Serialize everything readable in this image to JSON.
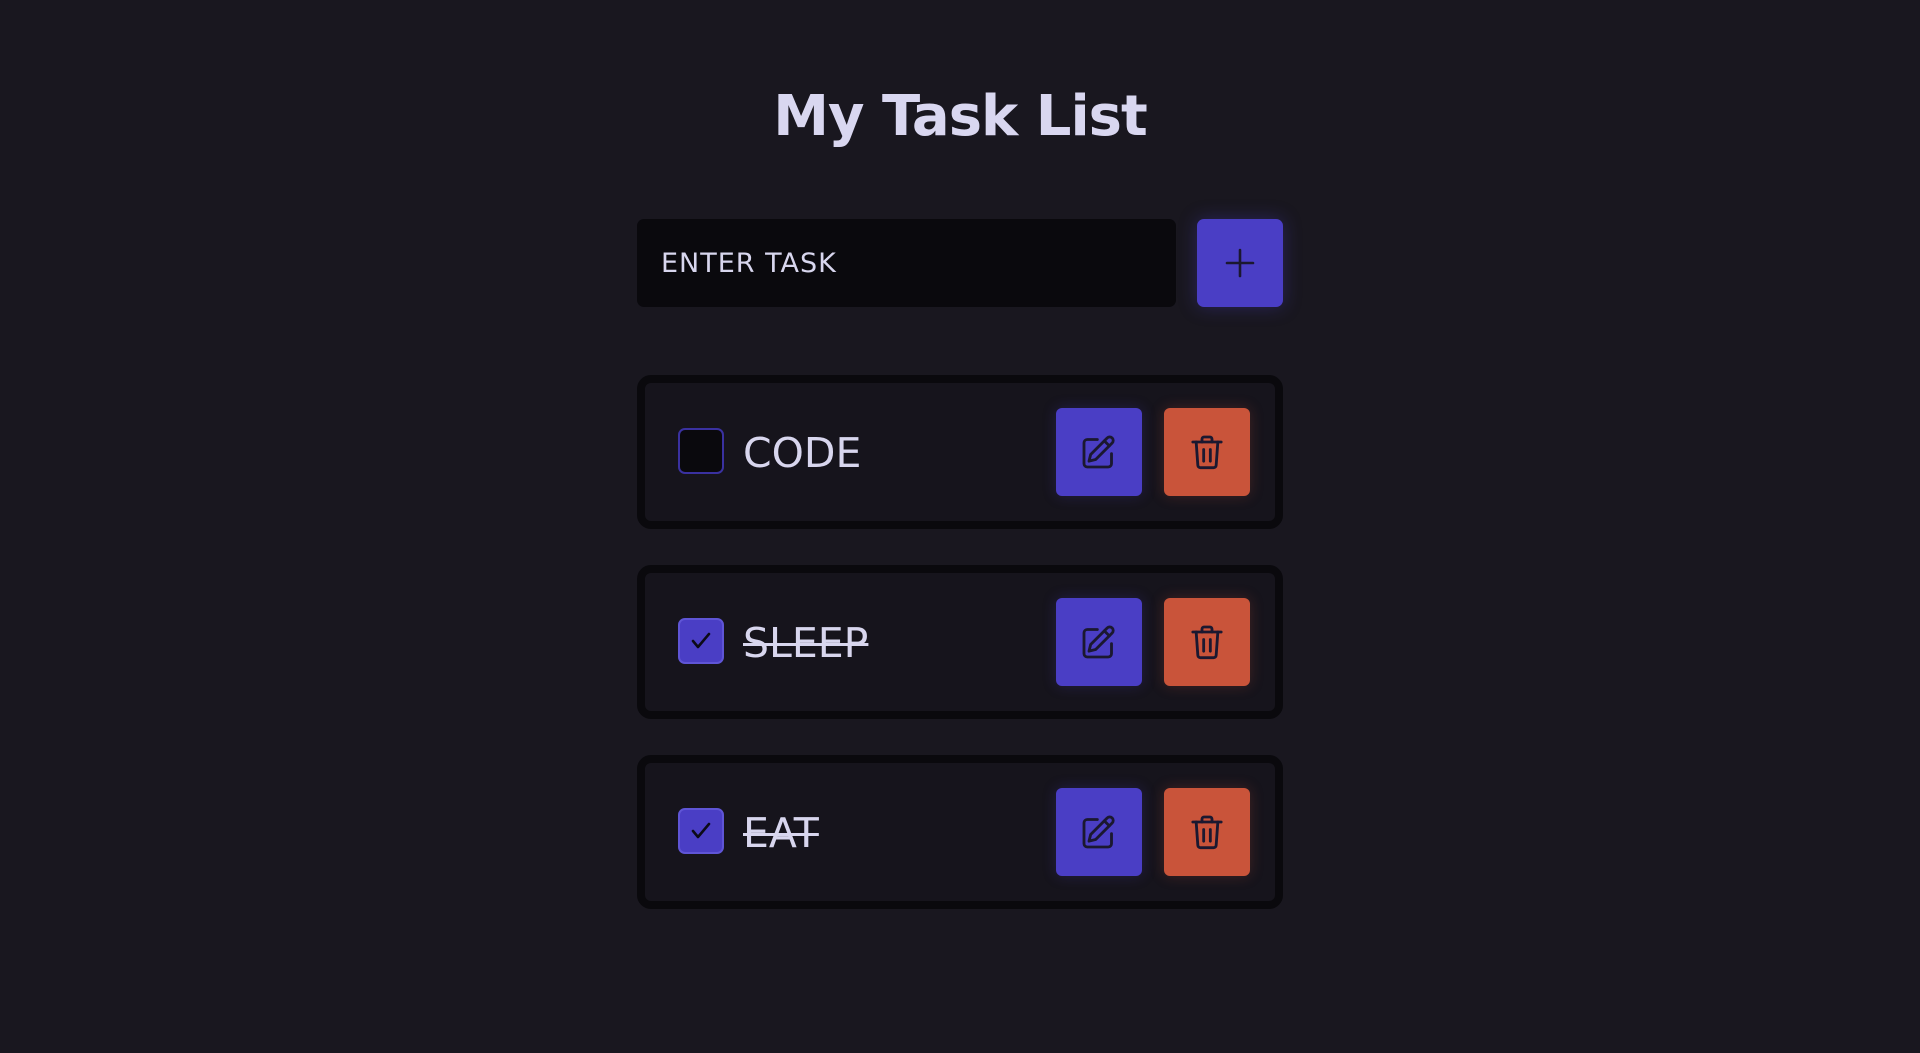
{
  "header": {
    "title": "My Task List"
  },
  "add_form": {
    "input_placeholder": "ENTER TASK",
    "input_value": "",
    "add_button_icon": "plus-icon"
  },
  "tasks": [
    {
      "label": "CODE",
      "completed": false
    },
    {
      "label": "SLEEP",
      "completed": true
    },
    {
      "label": "EAT",
      "completed": true
    }
  ],
  "task_actions": {
    "edit_icon": "pencil-square-icon",
    "delete_icon": "trash-icon"
  },
  "colors": {
    "background": "#19171f",
    "primary": "#4a3ec5",
    "danger": "#c9543a",
    "text": "#d8d6ee",
    "input_background": "#0a090d"
  }
}
